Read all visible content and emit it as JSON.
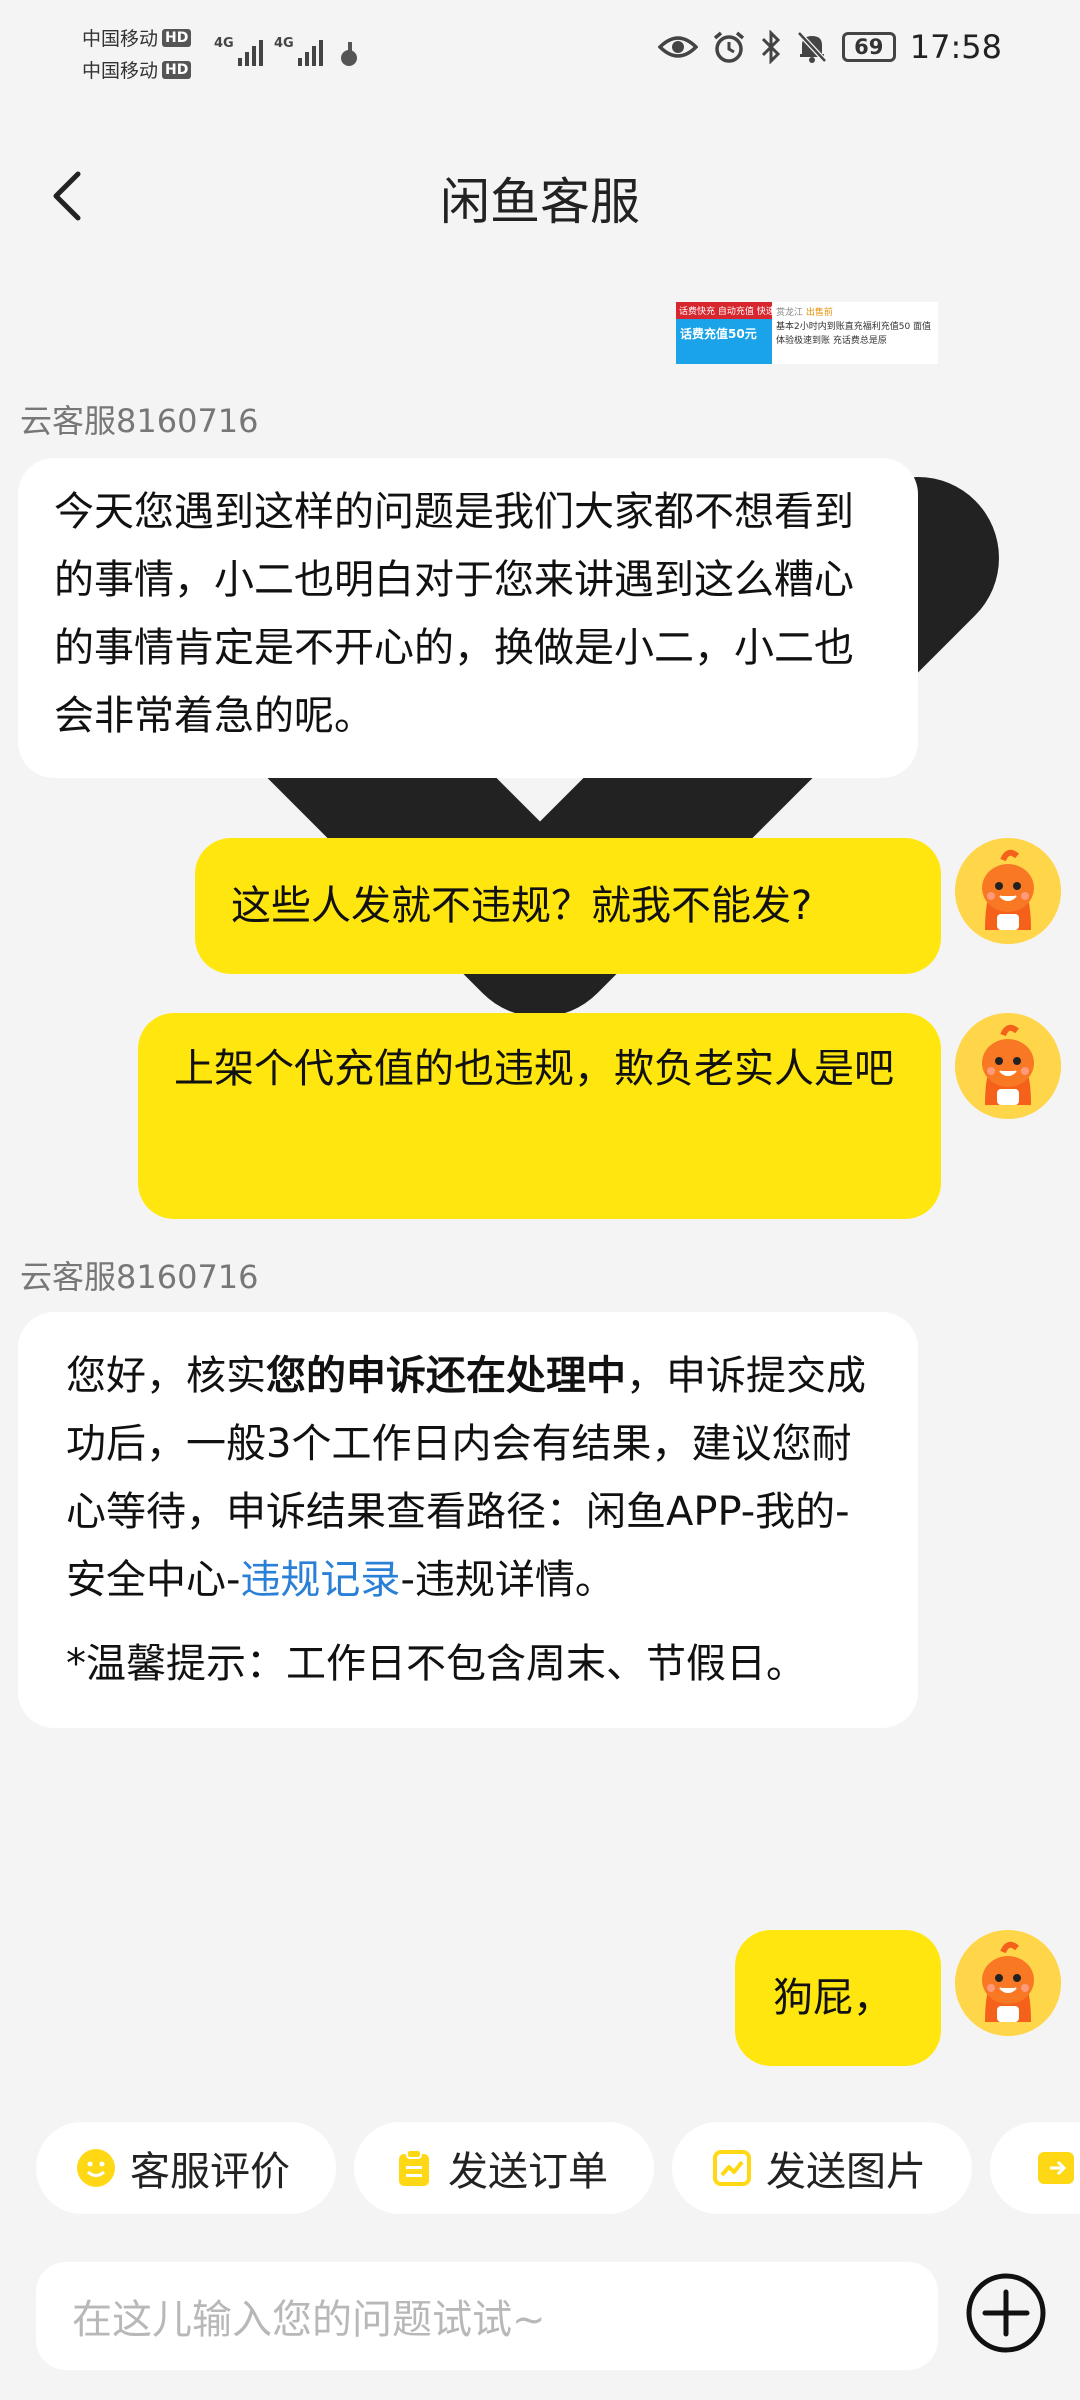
{
  "status_bar": {
    "carrier1": "中国移动",
    "carrier2": "中国移动",
    "hd": "HD",
    "net1": "4G",
    "net2": "4G",
    "battery": "69",
    "time": "17:58"
  },
  "nav": {
    "title": "闲鱼客服"
  },
  "banner": {
    "top_text": "话费快充 自动充值 快速到账",
    "amount": "话费充值50元",
    "seller": "赏龙江",
    "tag": "出售前",
    "desc": "基本2小时内到账直充福利充值50 面值体验极速到账 充话费总是原"
  },
  "messages": [
    {
      "sender": "云客服8160716",
      "text": "今天您遇到这样的问题是我们大家都不想看到的事情，小二也明白对于您来讲遇到这么糟心的事情肯定是不开心的，换做是小二，小二也会非常着急的呢。"
    },
    {
      "text": "这些人发就不违规？就我不能发?"
    },
    {
      "text": "上架个代充值的也违规，欺负老实人是吧"
    },
    {
      "sender": "云客服8160716",
      "p1_a": "您好，核实",
      "p1_b": "您的申诉还在处理中",
      "p1_c": "，申诉提交成功后，一般3个工作日内会有结果，建议您耐心等待，申诉结果查看路径：闲鱼APP-我的-安全中心-",
      "p1_link": "违规记录",
      "p1_d": "-违规详情。",
      "p2": "*温馨提示：工作日不包含周末、节假日。"
    },
    {
      "text": "狗屁，"
    }
  ],
  "quick_actions": [
    "客服评价",
    "发送订单",
    "发送图片"
  ],
  "input": {
    "placeholder": "在这儿输入您的问题试试~"
  },
  "colors": {
    "accent_yellow": "#ffe60f",
    "link_blue": "#2a7fd6",
    "background": "#f4f4f4"
  }
}
